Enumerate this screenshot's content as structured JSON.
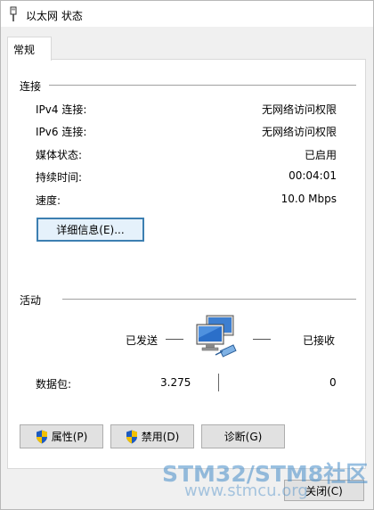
{
  "window": {
    "title": "以太网 状态"
  },
  "tabs": [
    {
      "label": "常规"
    }
  ],
  "connection": {
    "section_label": "连接",
    "rows": [
      {
        "label": "IPv4 连接:",
        "value": "无网络访问权限"
      },
      {
        "label": "IPv6 连接:",
        "value": "无网络访问权限"
      },
      {
        "label": "媒体状态:",
        "value": "已启用"
      },
      {
        "label": "持续时间:",
        "value": "00:04:01"
      },
      {
        "label": "速度:",
        "value": "10.0 Mbps"
      }
    ],
    "details_button": "详细信息(E)..."
  },
  "activity": {
    "section_label": "活动",
    "sent_label": "已发送",
    "received_label": "已接收",
    "packets_label": "数据包:",
    "packets_sent": "3.275",
    "packets_received": "0"
  },
  "buttons": {
    "properties": "属性(P)",
    "disable": "禁用(D)",
    "diagnose": "诊断(G)",
    "close": "关闭(C)"
  },
  "watermark": {
    "line1": "STM32/STM8社区",
    "line2": "www.stmcu.org"
  },
  "icons": [
    "network-cable-icon",
    "network-computer-icon",
    "shield-icon"
  ]
}
